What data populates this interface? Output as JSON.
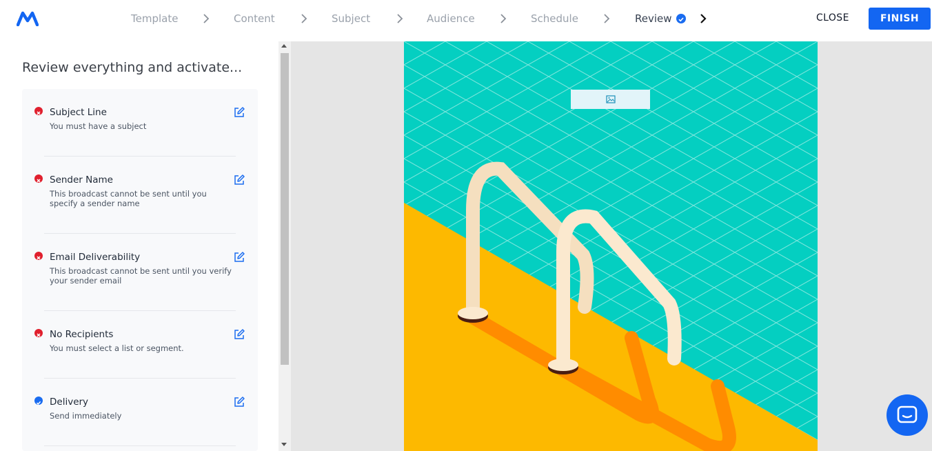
{
  "header": {
    "steps": [
      {
        "label": "Template"
      },
      {
        "label": "Content"
      },
      {
        "label": "Subject"
      },
      {
        "label": "Audience"
      },
      {
        "label": "Schedule"
      },
      {
        "label": "Review"
      }
    ],
    "active_step": "Review",
    "close_label": "CLOSE",
    "finish_label": "FINISH"
  },
  "panel": {
    "title": "Review everything and activate...",
    "items": [
      {
        "title": "Subject Line",
        "desc": "You must have a subject",
        "status": "error"
      },
      {
        "title": "Sender Name",
        "desc": "This broadcast cannot be sent until you specify a sender name",
        "status": "error"
      },
      {
        "title": "Email Deliverability",
        "desc": "This broadcast cannot be sent until you verify your sender email",
        "status": "error"
      },
      {
        "title": "No Recipients",
        "desc": "You must select a list or segment.",
        "status": "error"
      },
      {
        "title": "Delivery",
        "desc": "Send immediately",
        "status": "ok"
      }
    ]
  },
  "colors": {
    "accent": "#1366f2",
    "error": "#e0202e",
    "pool_water": "#04cfc1",
    "pool_deck": "#fdb900",
    "ladder": "#fbe9cf",
    "ladder_shadow": "#ff8c00"
  },
  "icons": {
    "logo": "brand-logo-icon",
    "chevron": "chevron-right-icon",
    "edit": "edit-icon",
    "image": "image-placeholder-icon",
    "chat": "chat-icon"
  }
}
